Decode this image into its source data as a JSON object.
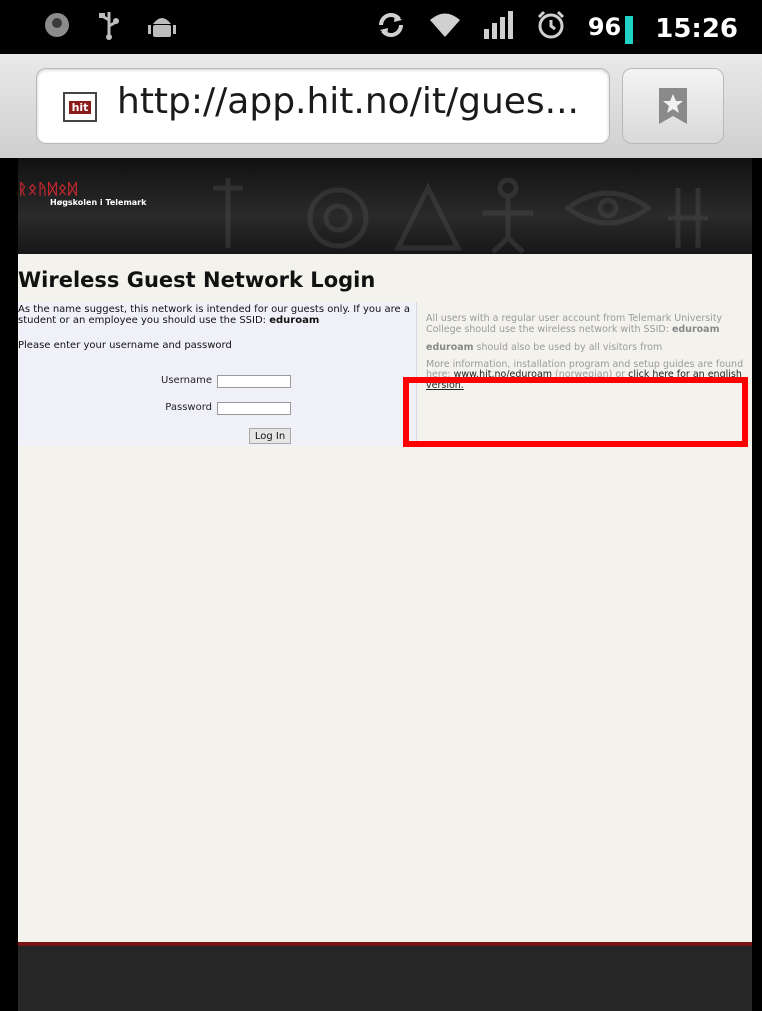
{
  "status_bar": {
    "icons_left": [
      "notification-icon",
      "usb-icon",
      "android-debug-icon"
    ],
    "icons_right": [
      "sync-icon",
      "wifi-icon",
      "signal-icon",
      "alarm-icon"
    ],
    "battery": "96",
    "time": "15:26"
  },
  "browser": {
    "favicon_text": "hit",
    "url": "http://app.hit.no/it/gues..."
  },
  "banner": {
    "logo_glyphs": "ᚱᛟᚤᛞᛟᛞ",
    "logo_subtitle": "Høgskolen i Telemark"
  },
  "page": {
    "title": "Wireless Guest Network Login",
    "intro_text": "As the name suggest, this network is intended for our guests only. If you are a student or an employee you should use the SSID: ",
    "intro_ssid": "eduroam",
    "prompt": "Please enter your username and password",
    "username_label": "Username",
    "password_label": "Password",
    "username_value": "",
    "password_value": "",
    "login_label": "Log In"
  },
  "info": {
    "p1_text": "All users with a regular user account from Telemark University College should use the wireless network with SSID: ",
    "p1_ssid": "eduroam",
    "p2_bold": "eduroam",
    "p2_text": " should also be used by all visitors from",
    "p3_text": "More information, installation program and setup guides are found here: ",
    "p3_link1": "www.hit.no/eduroam",
    "p3_mid": " (norwegian) or ",
    "p3_link2": "click here for an english version."
  },
  "colors": {
    "highlight": "#ff0000",
    "brand_red": "#c0282f",
    "battery": "#22d3c5"
  }
}
